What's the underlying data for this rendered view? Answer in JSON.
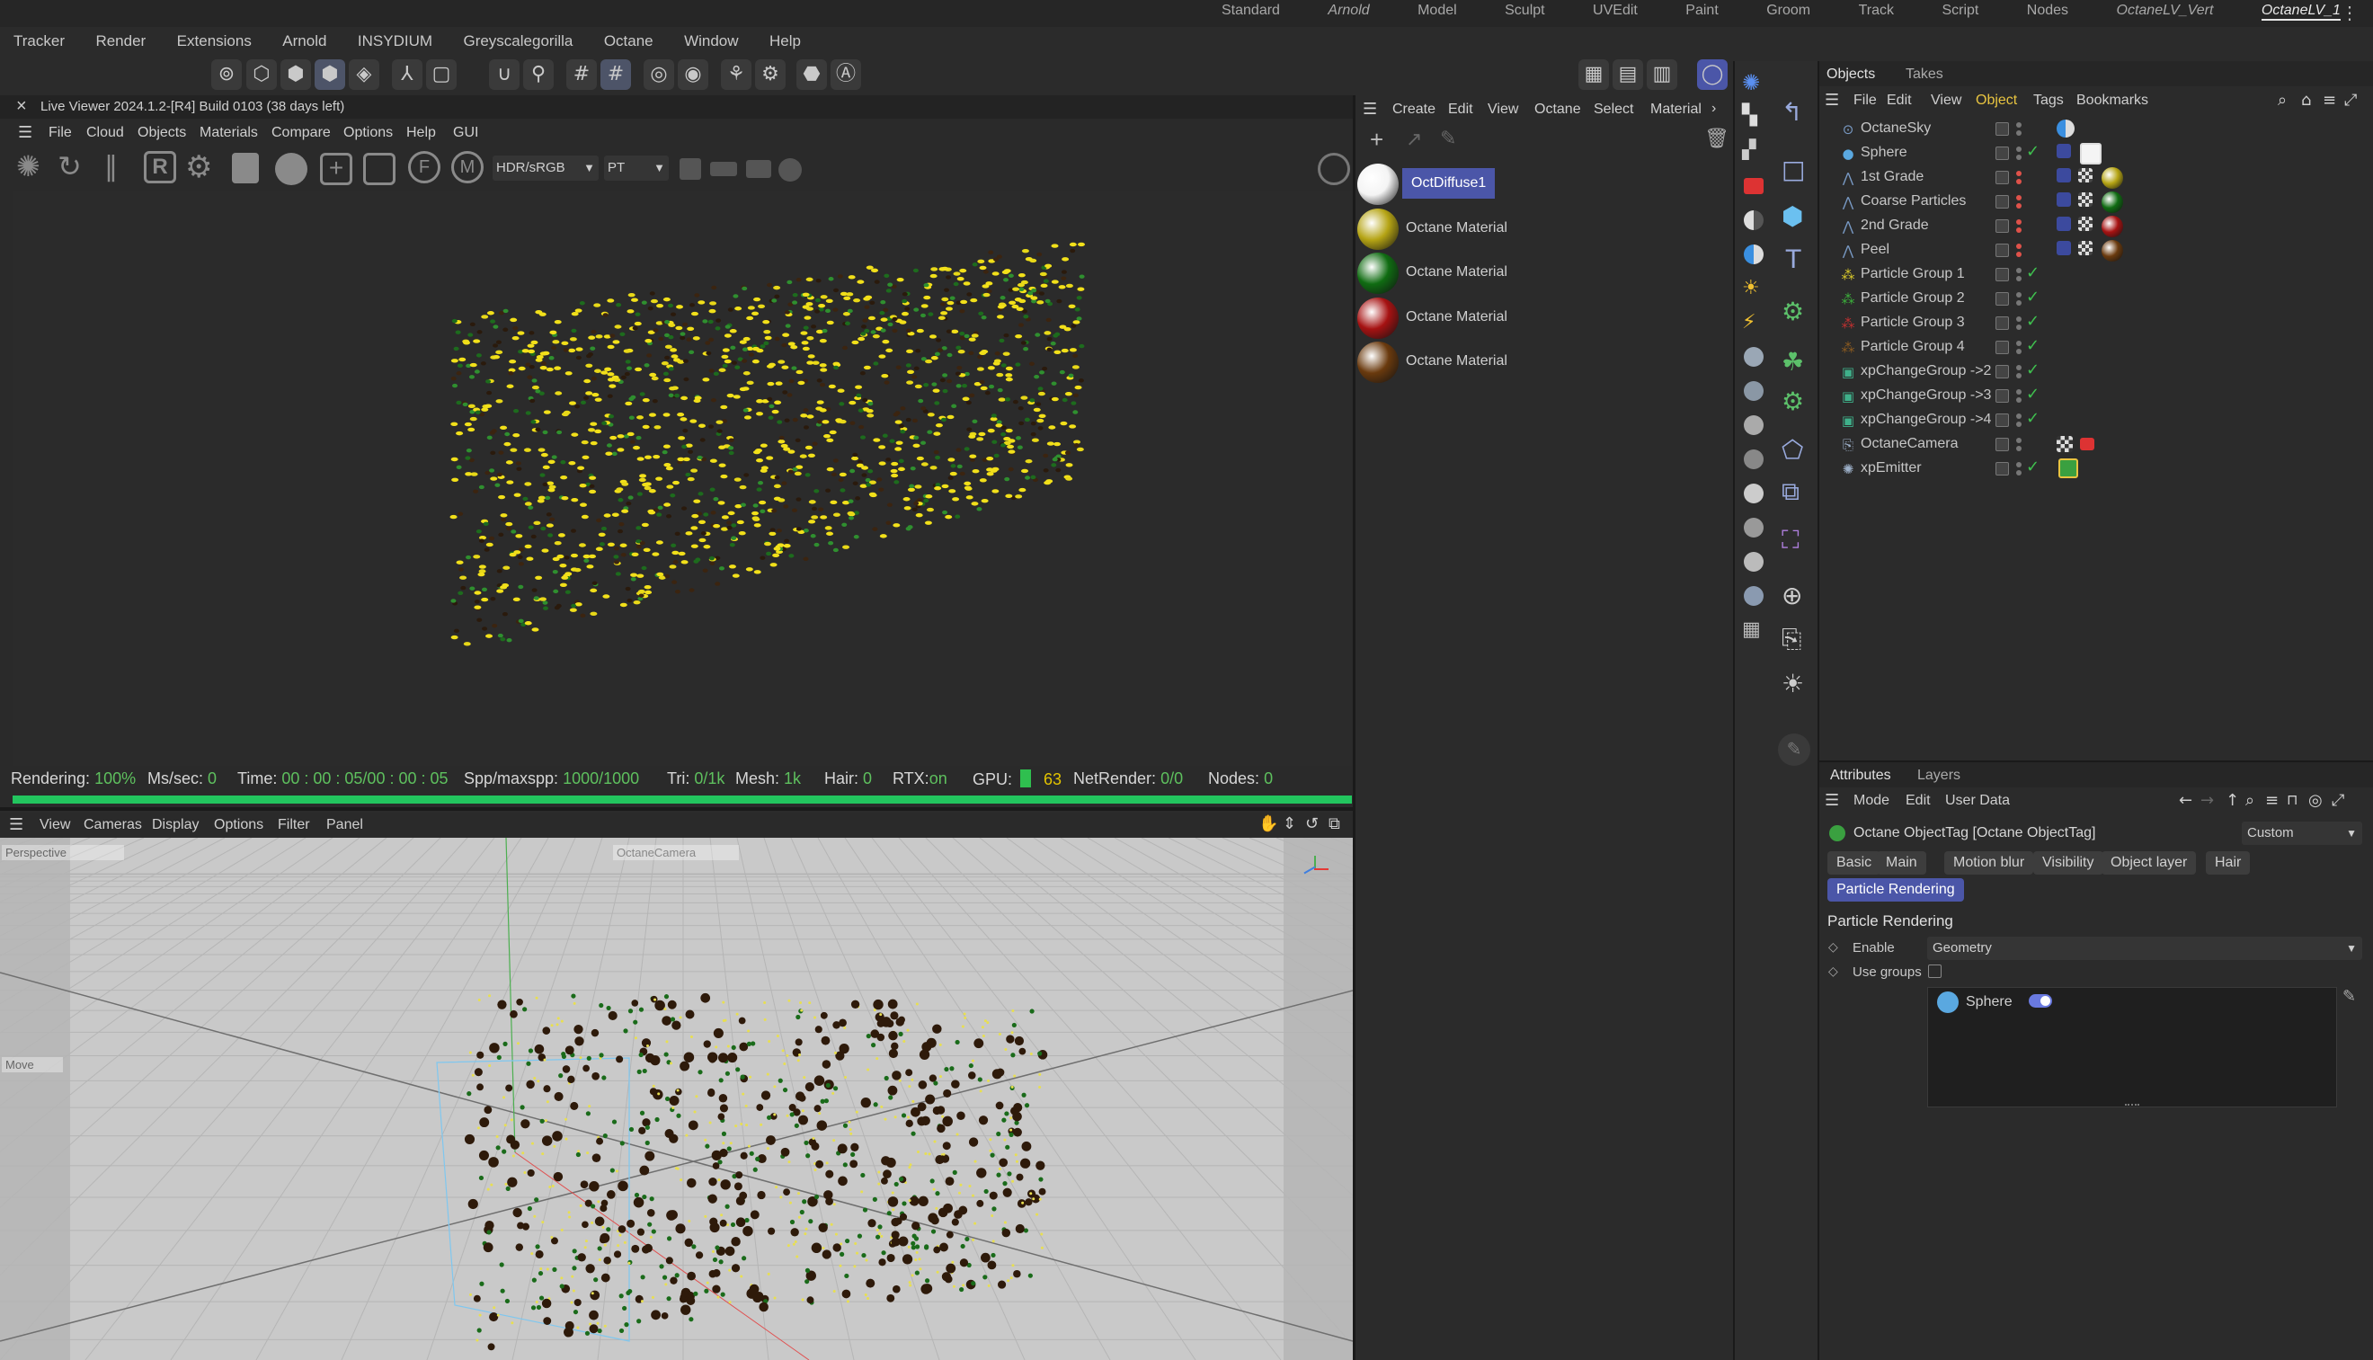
{
  "menubar": {
    "items": [
      "Tracker",
      "Render",
      "Extensions",
      "Arnold",
      "INSYDIUM",
      "Greyscalegorilla",
      "Octane",
      "Window",
      "Help"
    ],
    "layouts": [
      {
        "label": "Standard",
        "italic": false
      },
      {
        "label": "Arnold",
        "italic": true
      },
      {
        "label": "Model",
        "italic": false
      },
      {
        "label": "Sculpt",
        "italic": false
      },
      {
        "label": "UVEdit",
        "italic": false
      },
      {
        "label": "Paint",
        "italic": false
      },
      {
        "label": "Groom",
        "italic": false
      },
      {
        "label": "Track",
        "italic": false
      },
      {
        "label": "Script",
        "italic": false
      },
      {
        "label": "Nodes",
        "italic": false
      },
      {
        "label": "OctaneLV_Vert",
        "italic": true
      },
      {
        "label": "OctaneLV_1",
        "italic": true
      }
    ],
    "active_layout": "OctaneLV_1",
    "more_icon": "⋮"
  },
  "liveviewer": {
    "title": "Live Viewer 2024.1.2-[R4] Build 0103 (38 days left)",
    "close_icon": "×",
    "menu": [
      "File",
      "Cloud",
      "Objects",
      "Materials",
      "Compare",
      "Options",
      "Help",
      "GUI"
    ],
    "color_space": "HDR/sRGB",
    "kernel": "PT",
    "status": {
      "rendering_label": "Rendering:",
      "rendering_value": "100%",
      "ms_label": "Ms/sec:",
      "ms_value": "0",
      "time_label": "Time:",
      "time_value": "00 : 00 : 05/00 : 00 : 05",
      "spp_label": "Spp/maxspp:",
      "spp_value": "1000/1000",
      "tri_label": "Tri:",
      "tri_value": "0/1k",
      "mesh_label": "Mesh:",
      "mesh_value": "1k",
      "hair_label": "Hair:",
      "hair_value": "0",
      "rtx_label": "RTX:",
      "rtx_value": "on",
      "gpu_label": "GPU:",
      "gpu_value": "63",
      "net_label": "NetRender:",
      "net_value": "0/0",
      "nodes_label": "Nodes:",
      "nodes_value": "0"
    },
    "progress": 1.0
  },
  "viewport": {
    "menu": [
      "View",
      "Cameras",
      "Display",
      "Options",
      "Filter",
      "Panel"
    ],
    "camera_label": "Perspective",
    "camera_name": "OctaneCamera",
    "tool_label": "Move"
  },
  "materials": {
    "menu": [
      "Create",
      "Edit",
      "View",
      "Octane",
      "Select",
      "Material"
    ],
    "items": [
      {
        "name": "OctDiffuse1",
        "color": "#f4f4f4",
        "selected": true
      },
      {
        "name": "Octane Material",
        "color": "#b5a414",
        "selected": false
      },
      {
        "name": "Octane Material",
        "color": "#106c12",
        "selected": false
      },
      {
        "name": "Octane Material",
        "color": "#a61212",
        "selected": false
      },
      {
        "name": "Octane Material",
        "color": "#6a3a0e",
        "selected": false
      }
    ]
  },
  "objects": {
    "tabs": [
      "Objects",
      "Takes"
    ],
    "menu": [
      "File",
      "Edit",
      "View",
      "Object",
      "Tags",
      "Bookmarks"
    ],
    "rows": [
      {
        "name": "OctaneSky",
        "icon": "⊙",
        "icon_color": "#7a9cc7",
        "enabled_check": false
      },
      {
        "name": "Sphere",
        "icon": "●",
        "icon_color": "#5aa8e0",
        "enabled_check": true
      },
      {
        "name": "1st Grade",
        "icon": "⋀",
        "icon_color": "#7a9cc7",
        "enabled_check": false
      },
      {
        "name": "Coarse Particles",
        "icon": "⋀",
        "icon_color": "#7a9cc7",
        "enabled_check": false
      },
      {
        "name": "2nd Grade",
        "icon": "⋀",
        "icon_color": "#7a9cc7",
        "enabled_check": false
      },
      {
        "name": "Peel",
        "icon": "⋀",
        "icon_color": "#7a9cc7",
        "enabled_check": false
      },
      {
        "name": "Particle Group 1",
        "icon": "⁂",
        "icon_color": "#d8c82a",
        "enabled_check": true
      },
      {
        "name": "Particle Group 2",
        "icon": "⁂",
        "icon_color": "#3bb03b",
        "enabled_check": true
      },
      {
        "name": "Particle Group 3",
        "icon": "⁂",
        "icon_color": "#c03030",
        "enabled_check": true
      },
      {
        "name": "Particle Group 4",
        "icon": "⁂",
        "icon_color": "#8a5a20",
        "enabled_check": true
      },
      {
        "name": "xpChangeGroup ->2",
        "icon": "▣",
        "icon_color": "#3fb08a",
        "enabled_check": true
      },
      {
        "name": "xpChangeGroup ->3",
        "icon": "▣",
        "icon_color": "#3fb08a",
        "enabled_check": true
      },
      {
        "name": "xpChangeGroup ->4",
        "icon": "▣",
        "icon_color": "#3fb08a",
        "enabled_check": true
      },
      {
        "name": "OctaneCamera",
        "icon": "⎘",
        "icon_color": "#9db0c8",
        "enabled_check": false
      },
      {
        "name": "xpEmitter",
        "icon": "✺",
        "icon_color": "#9db0c8",
        "enabled_check": true
      }
    ]
  },
  "attributes": {
    "tabs": [
      "Attributes",
      "Layers"
    ],
    "menu": [
      "Mode",
      "Edit",
      "User Data"
    ],
    "object_title": "Octane ObjectTag [Octane ObjectTag]",
    "preset": "Custom",
    "subtabs": [
      "Basic",
      "Main",
      "Motion blur",
      "Visibility",
      "Object layer",
      "Hair"
    ],
    "active_subtab": "Particle Rendering",
    "section": "Particle Rendering",
    "enable_label": "Enable",
    "enable_value": "Geometry",
    "use_groups_label": "Use groups",
    "list_item": "Sphere"
  },
  "colors": {
    "accent": "#4b56a8",
    "green": "#3fc04f",
    "yellow": "#f2e01a",
    "progress": "#22c55e"
  }
}
